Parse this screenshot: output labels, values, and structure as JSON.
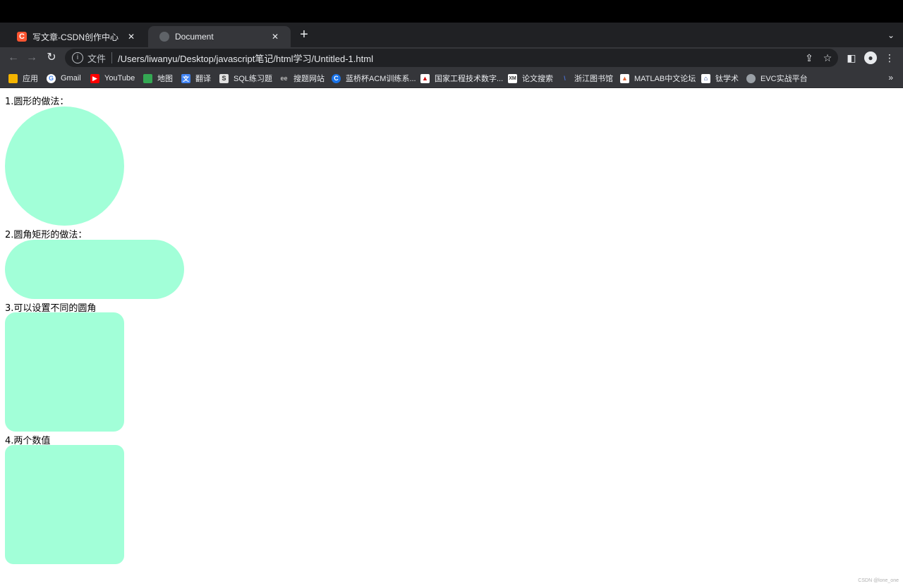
{
  "tabs": [
    {
      "title": "写文章-CSDN创作中心",
      "favicon": "csdn-logo-icon",
      "active": false
    },
    {
      "title": "Document",
      "favicon": "globe-icon",
      "active": true
    }
  ],
  "address_bar": {
    "scheme_label": "文件",
    "url": "/Users/liwanyu/Desktop/javascript笔记/html学习/Untitled-1.html"
  },
  "bookmarks": [
    {
      "label": "应用",
      "icon": "apps-grid-icon",
      "color": "#f4b400"
    },
    {
      "label": "Gmail",
      "icon": "google-icon",
      "color": "#ffffff"
    },
    {
      "label": "YouTube",
      "icon": "youtube-icon",
      "color": "#ff0000"
    },
    {
      "label": "地图",
      "icon": "maps-icon",
      "color": "#34a853"
    },
    {
      "label": "翻译",
      "icon": "translate-icon",
      "color": "#4285f4"
    },
    {
      "label": "SQL练习题",
      "icon": "sql-icon",
      "color": "#e0e0e0"
    },
    {
      "label": "搜题网站",
      "icon": "search-site-icon",
      "color": "#35363a"
    },
    {
      "label": "蓝桥杯ACM训练系...",
      "icon": "lanqiao-icon",
      "color": "#1a73e8"
    },
    {
      "label": "国家工程技术数字...",
      "icon": "engineering-library-icon",
      "color": "#ffffff"
    },
    {
      "label": "论文搜索",
      "icon": "paper-search-icon",
      "color": "#ffffff"
    },
    {
      "label": "浙江图书馆",
      "icon": "zhejiang-library-icon",
      "color": "#35363a"
    },
    {
      "label": "MATLAB中文论坛",
      "icon": "matlab-icon",
      "color": "#e16737"
    },
    {
      "label": "钛学术",
      "icon": "tixueshu-icon",
      "color": "#1a3a8a"
    },
    {
      "label": "EVC实战平台",
      "icon": "globe-icon",
      "color": "#9aa0a6"
    }
  ],
  "page": {
    "labels": [
      "1.圆形的做法：",
      "2.圆角矩形的做法：",
      "3.可以设置不同的圆角",
      "4.两个数值"
    ],
    "shape_color": "#a2ffd8"
  },
  "watermark": "CSDN @lone_one"
}
